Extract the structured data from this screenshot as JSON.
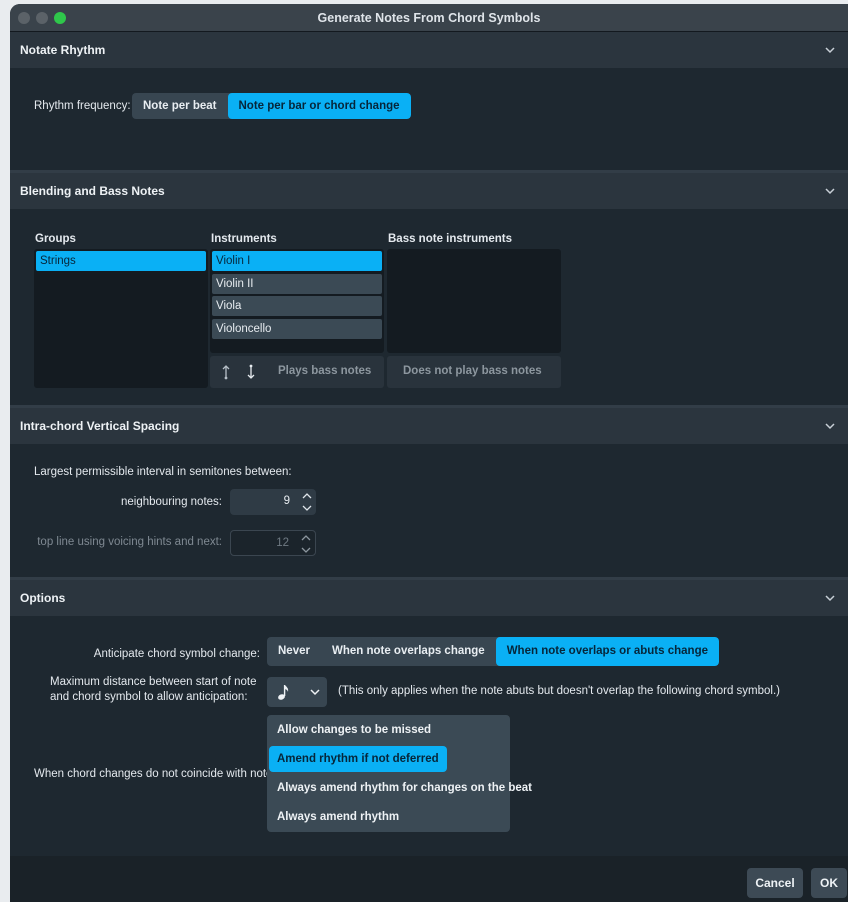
{
  "window": {
    "title": "Generate Notes From Chord Symbols"
  },
  "sections": {
    "rhythm": {
      "title": "Notate Rhythm",
      "frequency_label": "Rhythm frequency:",
      "options": [
        "Note per beat",
        "Note per bar or chord change"
      ],
      "selected": "Note per bar or chord change"
    },
    "blending": {
      "title": "Blending and Bass Notes",
      "groups_label": "Groups",
      "instruments_label": "Instruments",
      "bass_label": "Bass note instruments",
      "groups": [
        "Strings"
      ],
      "instruments": [
        "Violin I",
        "Violin II",
        "Viola",
        "Violoncello"
      ],
      "selected_group": "Strings",
      "selected_instrument": "Violin I",
      "plays_bass": "Plays bass notes",
      "not_plays_bass": "Does not play bass notes"
    },
    "spacing": {
      "title": "Intra-chord Vertical Spacing",
      "intro": "Largest permissible interval in semitones between:",
      "neighbouring_label": "neighbouring notes:",
      "neighbouring_value": "9",
      "topline_label": "top line using voicing hints and next:",
      "topline_value": "12"
    },
    "options": {
      "title": "Options",
      "anticipate_label": "Anticipate chord symbol change:",
      "anticipate_options": [
        "Never",
        "When note overlaps change",
        "When note overlaps or abuts change"
      ],
      "anticipate_selected": "When note overlaps or abuts change",
      "maxdist_label_1": "Maximum distance between start of note",
      "maxdist_label_2": "and chord symbol to allow anticipation:",
      "maxdist_note": "(This only applies when the note abuts but doesn't overlap the following chord symbol.)",
      "maxdist_icon": "eighth-note-icon",
      "coincide_label": "When chord changes do not coincide with notes:",
      "coincide_options": [
        "Allow changes to be missed",
        "Amend rhythm if not deferred",
        "Always amend rhythm for changes on the beat",
        "Always amend rhythm"
      ],
      "coincide_selected": "Amend rhythm if not deferred"
    }
  },
  "buttons": {
    "cancel": "Cancel",
    "ok": "OK"
  },
  "colors": {
    "accent": "#0ab0f5",
    "background": "#1e2830",
    "header": "#2b353e"
  }
}
